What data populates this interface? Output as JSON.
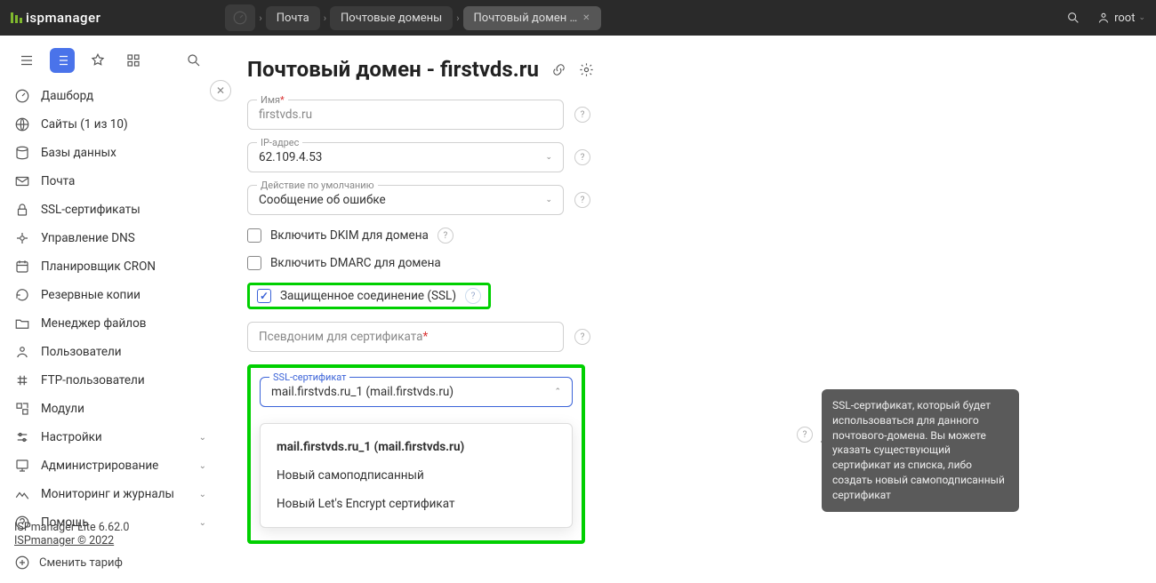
{
  "logo": "ispmanager",
  "breadcrumbs": {
    "mail": "Почта",
    "mail_domains": "Почтовые домены",
    "mail_domain": "Почтовый домен …"
  },
  "user": "root",
  "sidebar": {
    "items": [
      "Дашборд",
      "Сайты (1 из 10)",
      "Базы данных",
      "Почта",
      "SSL-сертификаты",
      "Управление DNS",
      "Планировщик CRON",
      "Резервные копии",
      "Менеджер файлов",
      "Пользователи",
      "FTP-пользователи",
      "Модули",
      "Настройки",
      "Администрирование",
      "Мониторинг и журналы",
      "Помощь"
    ],
    "version": "ISPmanager Lite 6.62.0",
    "copyright": "ISPmanager © 2022",
    "change_plan": "Сменить тариф"
  },
  "page": {
    "title": "Почтовый домен - firstvds.ru",
    "name_label": "Имя",
    "name_value": "firstvds.ru",
    "ip_label": "IP-адрес",
    "ip_value": "62.109.4.53",
    "default_label": "Действие по умолчанию",
    "default_value": "Сообщение об ошибке",
    "dkim": "Включить DKIM для домена",
    "dmarc": "Включить DMARC для домена",
    "ssl_enable": "Защищенное соединение (SSL)",
    "alias_label": "Псевдоним для сертификата",
    "cert_label": "SSL-сертификат",
    "cert_value": "mail.firstvds.ru_1 (mail.firstvds.ru)",
    "options": [
      "mail.firstvds.ru_1 (mail.firstvds.ru)",
      "Новый самоподписанный",
      "Новый Let's Encrypt сертификат"
    ],
    "tooltip": "SSL-сертификат, который будет использоваться для данного почтового-домена. Вы можете указать существующий сертификат из списка, либо создать новый самоподписанный сертификат"
  }
}
